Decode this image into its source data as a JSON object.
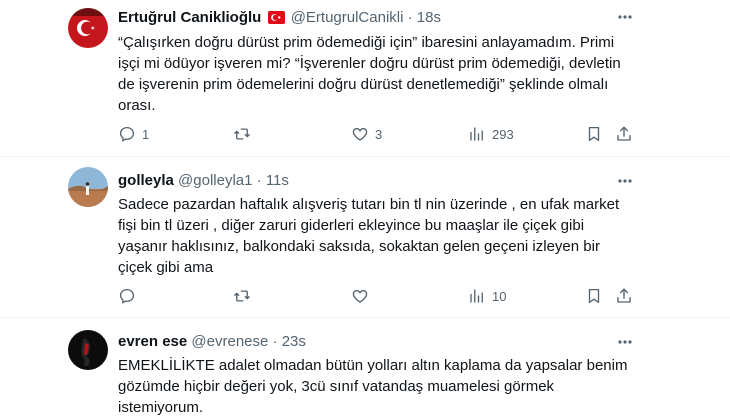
{
  "tweets": [
    {
      "name": "Ertuğrul Caniklioğlu",
      "flag": "🇹🇷",
      "handle": "@ErtugrulCanikli",
      "time": "18s",
      "text": "“Çalışırken doğru dürüst prim ödemediği için” ibaresini anlayamadım. Primi işçi mi ödüyor işveren mi? “İşverenler doğru dürüst prim ödemediği, devletin de işverenin prim ödemelerini doğru dürüst denetlemediği” şeklinde olmalı orası.",
      "replies": "1",
      "retweets": "",
      "likes": "3",
      "views": "293"
    },
    {
      "name": "golleyla",
      "handle": "@golleyla1",
      "time": "11s",
      "text": "Sadece pazardan haftalık alışveriş tutarı bin tl nin üzerinde , en ufak market fişi bin tl üzeri , diğer zaruri giderleri ekleyince bu maaşlar ile çiçek gibi yaşanır haklısınız, balkondaki saksıda, sokaktan gelen geçeni izleyen bir çiçek gibi ama",
      "replies": "",
      "retweets": "",
      "likes": "",
      "views": "10"
    },
    {
      "name": "evren ese",
      "handle": "@evrenese",
      "time": "23s",
      "text": "EMEKLİLİKTE adalet olmadan bütün yolları altın kaplama da yapsalar benim gözümde hiçbir değeri yok, 3cü sınıf vatandaş muamelesi görmek istemiyorum."
    }
  ],
  "colors": {
    "text": "#0f1419",
    "secondary": "#536471",
    "divider": "#eff3f4"
  }
}
